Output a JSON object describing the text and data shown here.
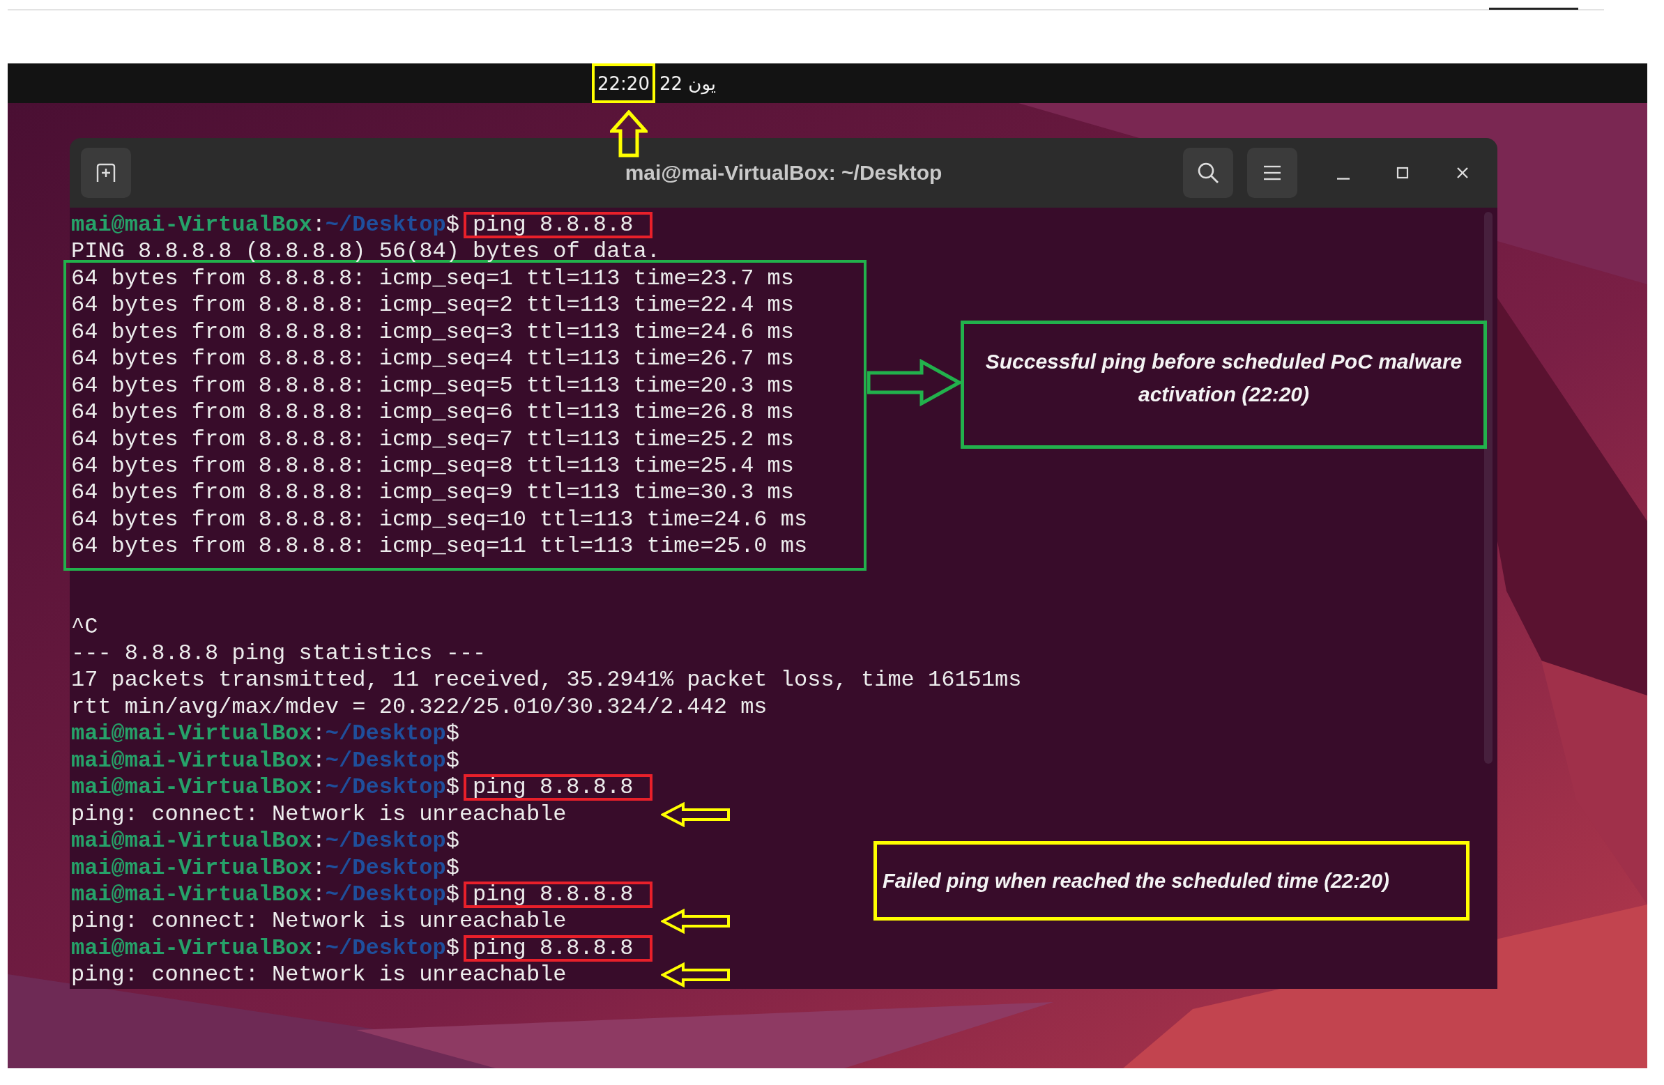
{
  "top_bar": {
    "time": "22:20",
    "date": "يون 22",
    "time_highlighted": true
  },
  "terminal": {
    "title": "mai@mai-VirtualBox: ~/Desktop",
    "lines": [
      {
        "kind": "prompt",
        "host": "mai@mai-VirtualBox",
        "sep": ":",
        "path": "~/Desktop",
        "symbol": "$",
        "command": "ping 8.8.8.8",
        "highlighted": true
      },
      {
        "kind": "output",
        "text": "PING 8.8.8.8 (8.8.8.8) 56(84) bytes of data."
      },
      {
        "kind": "group",
        "boxed": true,
        "lines": [
          {
            "kind": "output",
            "text": "64 bytes from 8.8.8.8: icmp_seq=1 ttl=113 time=23.7 ms"
          },
          {
            "kind": "output",
            "text": "64 bytes from 8.8.8.8: icmp_seq=2 ttl=113 time=22.4 ms"
          },
          {
            "kind": "output",
            "text": "64 bytes from 8.8.8.8: icmp_seq=3 ttl=113 time=24.6 ms"
          },
          {
            "kind": "output",
            "text": "64 bytes from 8.8.8.8: icmp_seq=4 ttl=113 time=26.7 ms"
          },
          {
            "kind": "output",
            "text": "64 bytes from 8.8.8.8: icmp_seq=5 ttl=113 time=20.3 ms"
          },
          {
            "kind": "output",
            "text": "64 bytes from 8.8.8.8: icmp_seq=6 ttl=113 time=26.8 ms"
          },
          {
            "kind": "output",
            "text": "64 bytes from 8.8.8.8: icmp_seq=7 ttl=113 time=25.2 ms"
          },
          {
            "kind": "output",
            "text": "64 bytes from 8.8.8.8: icmp_seq=8 ttl=113 time=25.4 ms"
          },
          {
            "kind": "output",
            "text": "64 bytes from 8.8.8.8: icmp_seq=9 ttl=113 time=30.3 ms"
          },
          {
            "kind": "output",
            "text": "64 bytes from 8.8.8.8: icmp_seq=10 ttl=113 time=24.6 ms"
          },
          {
            "kind": "output",
            "text": "64 bytes from 8.8.8.8: icmp_seq=11 ttl=113 time=25.0 ms"
          }
        ]
      },
      {
        "kind": "blank"
      },
      {
        "kind": "blank"
      },
      {
        "kind": "output",
        "text": "^C"
      },
      {
        "kind": "output",
        "text": "--- 8.8.8.8 ping statistics ---"
      },
      {
        "kind": "output",
        "text": "17 packets transmitted, 11 received, 35.2941% packet loss, time 16151ms"
      },
      {
        "kind": "output",
        "text": "rtt min/avg/max/mdev = 20.322/25.010/30.324/2.442 ms"
      },
      {
        "kind": "prompt",
        "host": "mai@mai-VirtualBox",
        "sep": ":",
        "path": "~/Desktop",
        "symbol": "$"
      },
      {
        "kind": "prompt",
        "host": "mai@mai-VirtualBox",
        "sep": ":",
        "path": "~/Desktop",
        "symbol": "$"
      },
      {
        "kind": "prompt",
        "host": "mai@mai-VirtualBox",
        "sep": ":",
        "path": "~/Desktop",
        "symbol": "$",
        "command": "ping 8.8.8.8",
        "highlighted": true
      },
      {
        "kind": "output",
        "text": "ping: connect: Network is unreachable",
        "arrow": true
      },
      {
        "kind": "prompt",
        "host": "mai@mai-VirtualBox",
        "sep": ":",
        "path": "~/Desktop",
        "symbol": "$"
      },
      {
        "kind": "prompt",
        "host": "mai@mai-VirtualBox",
        "sep": ":",
        "path": "~/Desktop",
        "symbol": "$"
      },
      {
        "kind": "prompt",
        "host": "mai@mai-VirtualBox",
        "sep": ":",
        "path": "~/Desktop",
        "symbol": "$",
        "command": "ping 8.8.8.8",
        "highlighted": true
      },
      {
        "kind": "output",
        "text": "ping: connect: Network is unreachable",
        "arrow": true
      },
      {
        "kind": "prompt",
        "host": "mai@mai-VirtualBox",
        "sep": ":",
        "path": "~/Desktop",
        "symbol": "$",
        "command": "ping 8.8.8.8",
        "highlighted": true
      },
      {
        "kind": "output",
        "text": "ping: connect: Network is unreachable",
        "arrow": true
      }
    ]
  },
  "annotations": [
    {
      "kind": "callout",
      "color": "#22b14c",
      "text": "Successful ping before scheduled PoC malware activation (22:20)",
      "pointer": true
    },
    {
      "kind": "callout",
      "color": "#ffff00",
      "text": "Failed ping when reached the scheduled time (22:20)",
      "pointer": false
    }
  ]
}
